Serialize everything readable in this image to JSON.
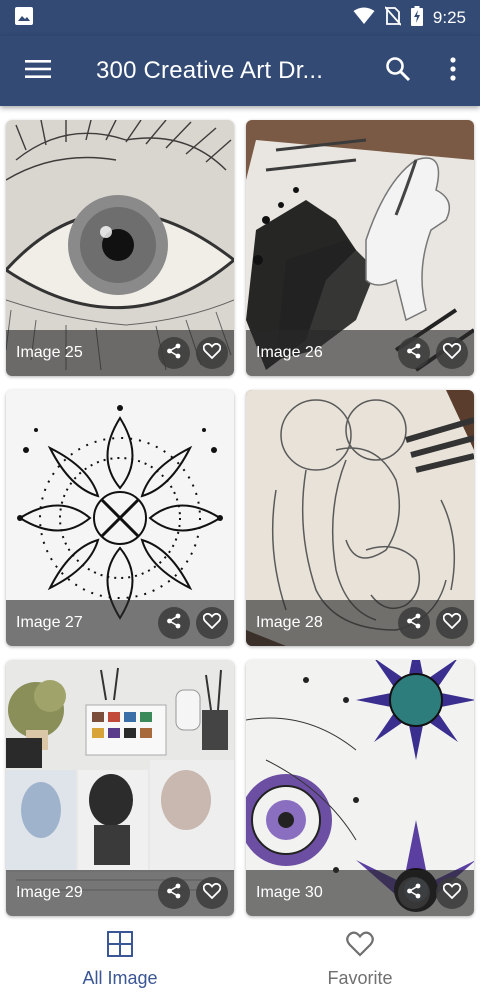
{
  "status_bar": {
    "time": "9:25"
  },
  "app_bar": {
    "title": "300 Creative Art Dr..."
  },
  "images": [
    {
      "caption": "Image 25",
      "art": "eye"
    },
    {
      "caption": "Image 26",
      "art": "horse"
    },
    {
      "caption": "Image 27",
      "art": "mandala"
    },
    {
      "caption": "Image 28",
      "art": "woman"
    },
    {
      "caption": "Image 29",
      "art": "studio"
    },
    {
      "caption": "Image 30",
      "art": "sun"
    }
  ],
  "bottom_nav": {
    "items": [
      {
        "label": "All Image",
        "icon": "grid-icon",
        "active": true
      },
      {
        "label": "Favorite",
        "icon": "heart-icon",
        "active": false
      }
    ]
  },
  "colors": {
    "primary": "#324a74",
    "accent": "#3b5694"
  }
}
